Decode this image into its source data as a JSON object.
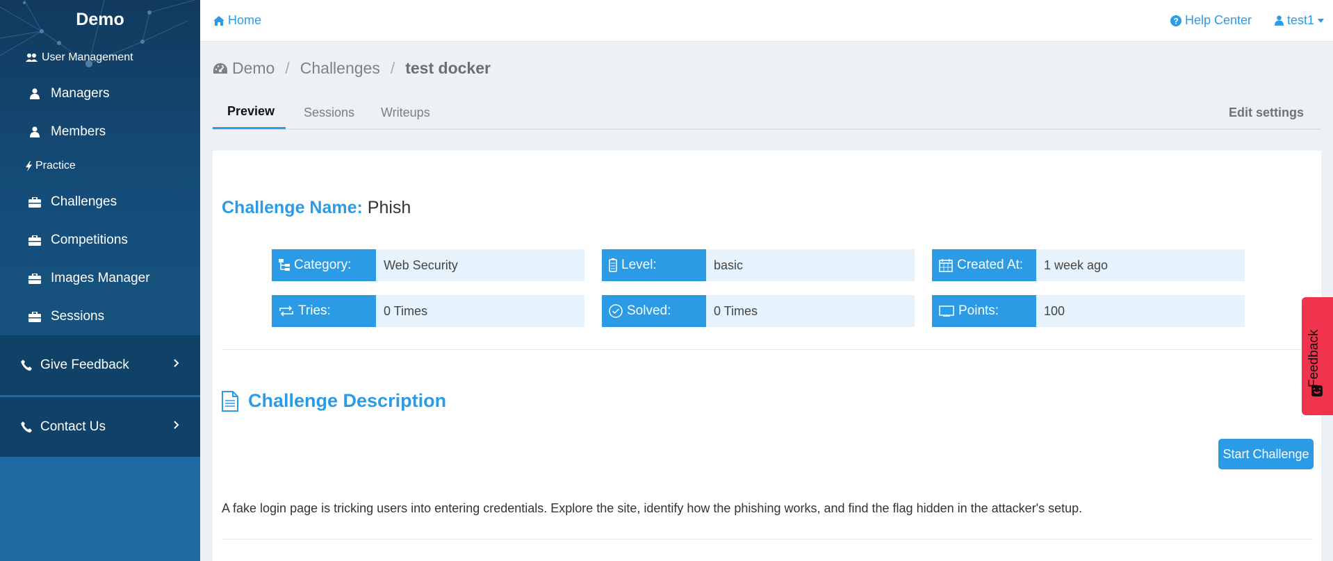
{
  "sidebar": {
    "brand": "Demo",
    "sections": [
      {
        "label": "User Management",
        "icon": "users-icon"
      },
      {
        "label": "Practice",
        "icon": "bolt-icon"
      }
    ],
    "items": [
      {
        "label": "Managers",
        "icon": "user-icon"
      },
      {
        "label": "Members",
        "icon": "user-icon"
      },
      {
        "label": "Challenges",
        "icon": "briefcase-icon"
      },
      {
        "label": "Competitions",
        "icon": "briefcase-icon"
      },
      {
        "label": "Images Manager",
        "icon": "briefcase-icon"
      },
      {
        "label": "Sessions",
        "icon": "briefcase-icon"
      }
    ],
    "footer": [
      {
        "label": "Give Feedback",
        "icon": "phone-icon"
      },
      {
        "label": "Contact Us",
        "icon": "phone-icon"
      }
    ]
  },
  "topbar": {
    "home": "Home",
    "help": "Help Center",
    "user": "test1"
  },
  "breadcrumb": [
    "Demo",
    "Challenges",
    "test docker"
  ],
  "tabs": [
    "Preview",
    "Sessions",
    "Writeups"
  ],
  "edit_settings": "Edit settings",
  "challenge": {
    "name_label": "Challenge Name:",
    "name": "Phish",
    "info": [
      {
        "key": "Category:",
        "value": "Web Security",
        "icon": "sitemap-icon"
      },
      {
        "key": "Level:",
        "value": "basic",
        "icon": "battery-icon"
      },
      {
        "key": "Created At:",
        "value": "1 week ago",
        "icon": "calendar-icon"
      },
      {
        "key": "Tries:",
        "value": "0 Times",
        "icon": "retry-icon"
      },
      {
        "key": "Solved:",
        "value": "0 Times",
        "icon": "check-circle-icon"
      },
      {
        "key": "Points:",
        "value": "100",
        "icon": "display-icon"
      }
    ],
    "description_title": "Challenge Description",
    "start_button": "Start Challenge",
    "description": "A fake login page is tricking users into entering credentials. Explore the site, identify how the phishing works, and find the flag hidden in the attacker's setup."
  },
  "feedback_tab": "Feedback",
  "colors": {
    "accent": "#2b9be6",
    "sidebar": "#154d7a",
    "feedback": "#f0344e"
  }
}
